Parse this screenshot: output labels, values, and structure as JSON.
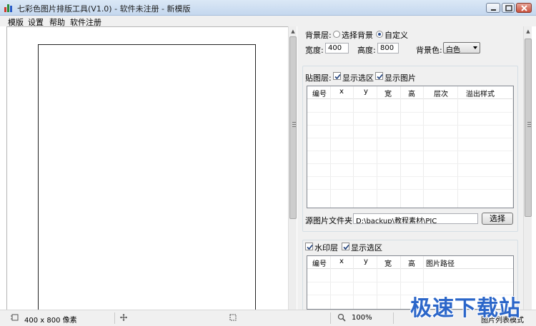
{
  "window": {
    "title": "七彩色图片排版工具(V1.0) - 软件未注册 - 新模版"
  },
  "menu": {
    "items": [
      "模版",
      "设置",
      "帮助",
      "软件注册"
    ]
  },
  "background_layer": {
    "label": "背景层:",
    "option_select": "选择背景",
    "option_custom": "自定义",
    "selected": "自定义",
    "width_label": "宽度:",
    "width_value": "400",
    "height_label": "高度:",
    "height_value": "800",
    "color_label": "背景色:",
    "color_value": "白色"
  },
  "sticker_layer": {
    "label": "贴图层:",
    "show_selection": "显示选区",
    "show_selection_checked": true,
    "show_image": "显示图片",
    "show_image_checked": true,
    "columns": [
      "编号",
      "x",
      "y",
      "宽",
      "高",
      "层次",
      "溢出样式"
    ],
    "source_folder_label": "源图片文件夹:",
    "source_folder_value": "D:\\backup\\教程素材\\PIC",
    "choose_button": "选择"
  },
  "watermark_layer": {
    "label": "水印层",
    "checked": true,
    "show_selection": "显示选区",
    "show_selection_checked": true,
    "columns": [
      "编号",
      "x",
      "y",
      "宽",
      "高",
      "图片路径"
    ]
  },
  "status": {
    "size_text": "400 x 800 像素",
    "zoom_text": "100%",
    "mode_text": "图片列表模式"
  },
  "watermark_logo": "极速下载站",
  "colors": {
    "titlebar": "#c4d7ee",
    "panel_bg": "#f0f0f0",
    "logo_blue": "#2b66c9"
  },
  "icons": {
    "app": "app-bars-icon",
    "minimize": "minimize-icon",
    "maximize": "maximize-icon",
    "close": "close-icon",
    "canvas_size": "canvas-size-icon",
    "move": "move-cross-icon",
    "fit": "fit-icon",
    "zoom": "magnifier-icon"
  }
}
